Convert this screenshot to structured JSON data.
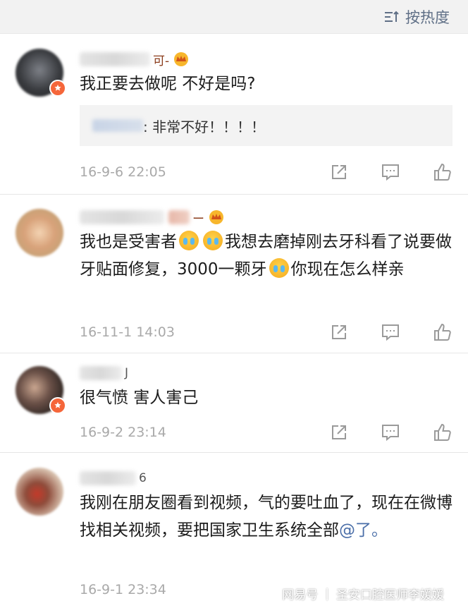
{
  "header": {
    "sort_label": "按热度"
  },
  "comments": [
    {
      "name_suffix": "可-",
      "text": "我正要去做呢 不好是吗?",
      "reply": {
        "text": ": 非常不好！！！！"
      },
      "time": "16-9-6 22:05"
    },
    {
      "name_suffix": "ー",
      "text_parts": [
        "我也是受害者",
        "我想去磨掉刚去牙科看了说要做牙贴面修复，3000一颗牙",
        "你现在怎么样亲"
      ],
      "time": "16-11-1 14:03"
    },
    {
      "name_suffix": "J",
      "text": "很气愤 害人害己",
      "time": "16-9-2 23:14"
    },
    {
      "name_suffix": "6",
      "text_before": "我刚在朋友圈看到视频，气的要吐血了，现在在微博找相关视频，要把国家卫生系统全部",
      "mention": "@了。",
      "time": "16-9-1 23:34"
    }
  ],
  "watermark": {
    "brand": "网易号",
    "author": "圣安口腔医师李媛媛"
  },
  "colors": {
    "accent": "#5f6f86",
    "badge": "#f5663a",
    "timestamp": "#a9a9a9"
  }
}
